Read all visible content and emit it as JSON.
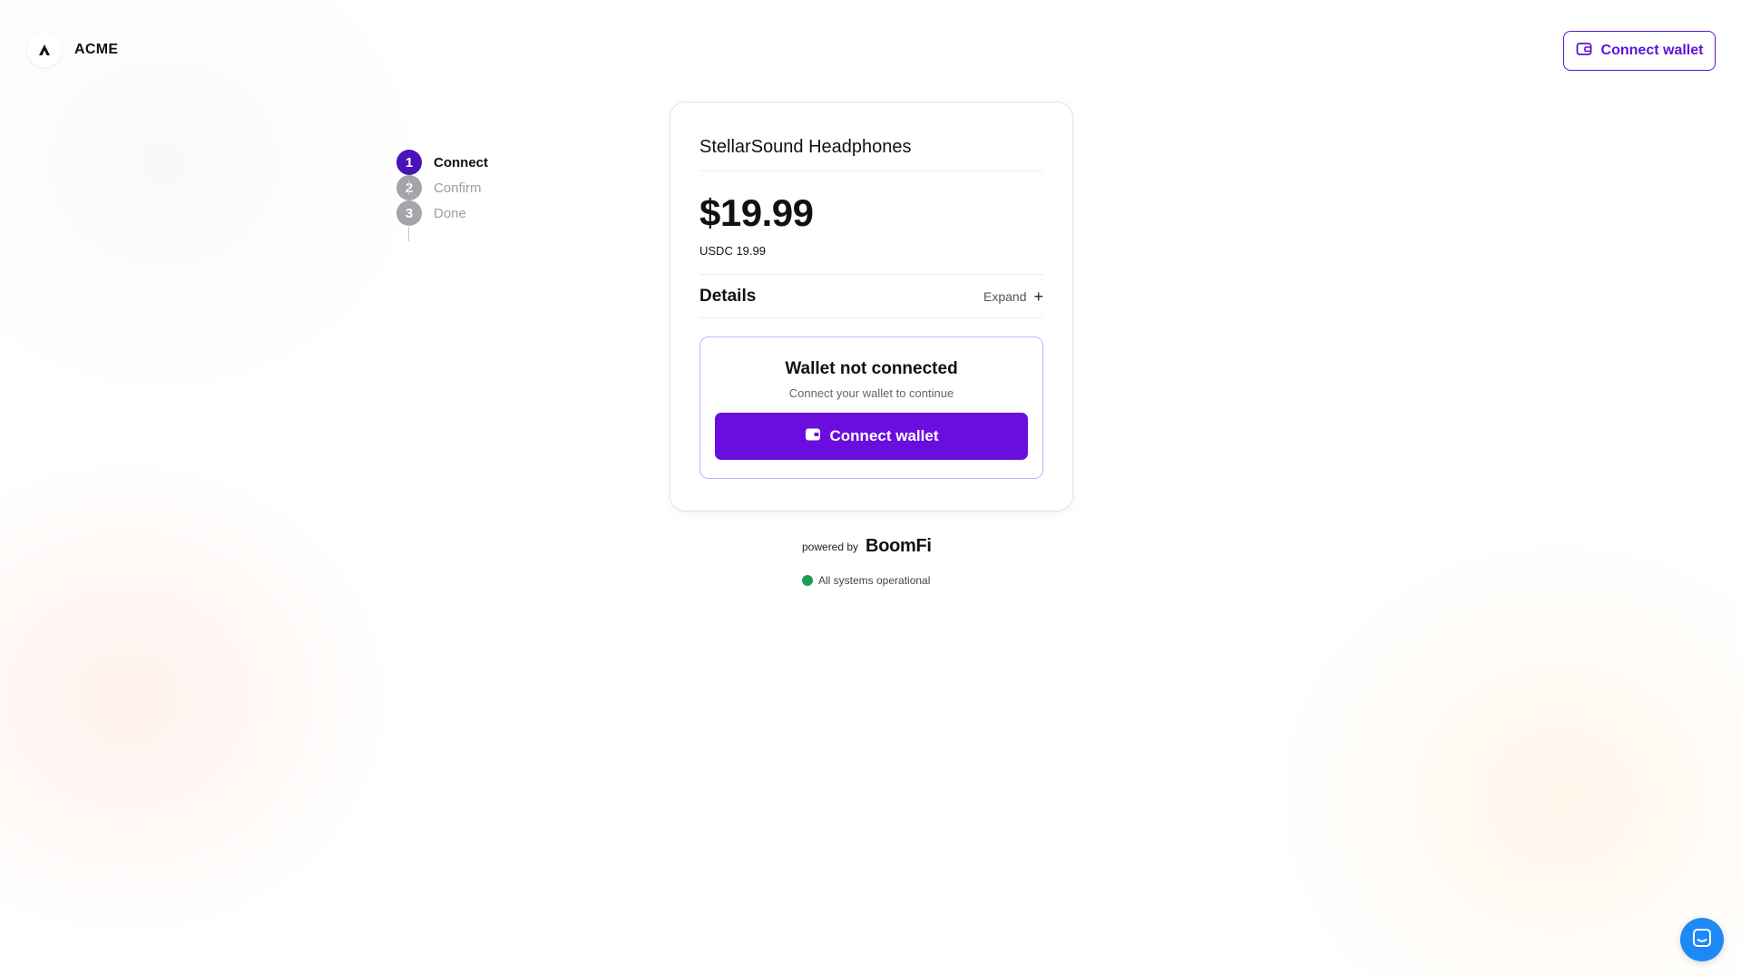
{
  "header": {
    "brand_name": "ACME",
    "connect_wallet_label": "Connect wallet"
  },
  "stepper": {
    "steps": [
      {
        "number": "1",
        "label": "Connect",
        "state": "active"
      },
      {
        "number": "2",
        "label": "Confirm",
        "state": "inactive"
      },
      {
        "number": "3",
        "label": "Done",
        "state": "inactive"
      }
    ]
  },
  "card": {
    "product_title": "StellarSound Headphones",
    "price": "$19.99",
    "price_sub": "USDC 19.99",
    "details_label": "Details",
    "expand_label": "Expand",
    "expand_icon": "+",
    "wallet": {
      "title": "Wallet not connected",
      "subtitle": "Connect your wallet to continue",
      "button_label": "Connect wallet"
    }
  },
  "footer": {
    "powered_by": "powered by",
    "provider": "BoomFi",
    "status_text": "All systems operational"
  },
  "colors": {
    "accent": "#6a0ee0",
    "accent_dark": "#4a12b8",
    "status_ok": "#1f9d55",
    "chat": "#1e88f5"
  },
  "icons": {
    "brand": "acme-logo-icon",
    "wallet": "wallet-icon",
    "chat": "chat-icon",
    "status": "status-dot-icon"
  }
}
